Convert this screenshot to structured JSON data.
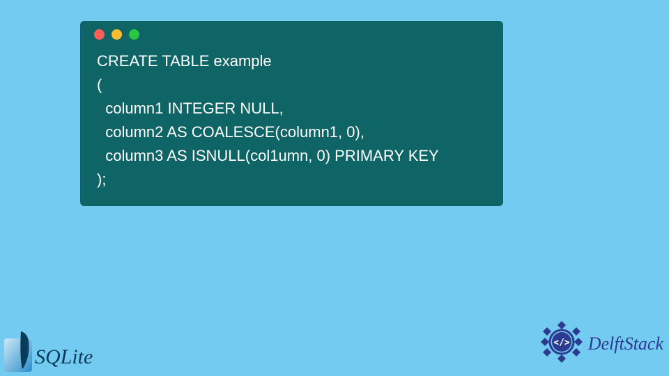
{
  "colors": {
    "page_bg": "#74CBF2",
    "window_bg": "#0F6466",
    "code_text": "#FFFFFF",
    "dot_red": "#FF5F57",
    "dot_yellow": "#FEBC2E",
    "dot_green": "#28C840",
    "sqlite_blue_light": "#9FD4F0",
    "sqlite_blue_dark": "#0E6BA8",
    "sqlite_text": "#0a3a5a",
    "delft_blue": "#2C3A8F"
  },
  "window": {
    "controls": [
      "close",
      "minimize",
      "maximize"
    ]
  },
  "code": {
    "lines": [
      "CREATE TABLE example",
      "(",
      "  column1 INTEGER NULL,",
      "  column2 AS COALESCE(column1, 0),",
      "  column3 AS ISNULL(col1umn, 0) PRIMARY KEY",
      ");"
    ],
    "full_text": "CREATE TABLE example\n(\n  column1 INTEGER NULL,\n  column2 AS COALESCE(column1, 0),\n  column3 AS ISNULL(col1umn, 0) PRIMARY KEY\n);"
  },
  "logos": {
    "sqlite": {
      "text": "SQLite",
      "icon_name": "feather-icon"
    },
    "delftstack": {
      "text": "DelftStack",
      "icon_name": "code-badge-icon"
    }
  }
}
